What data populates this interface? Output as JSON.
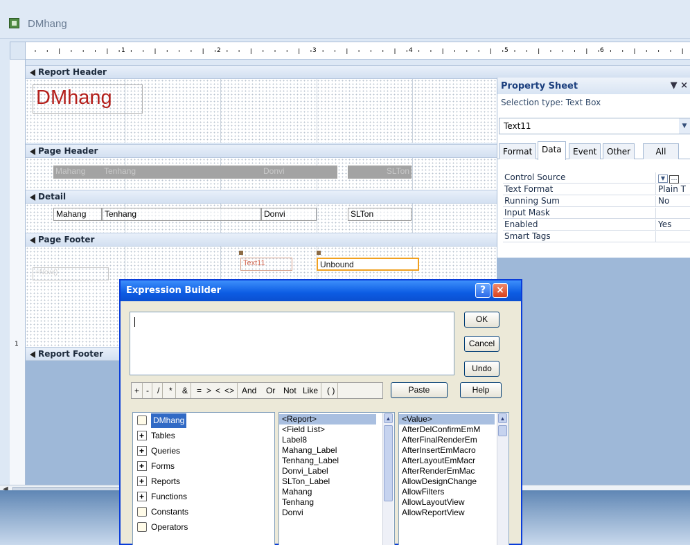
{
  "window": {
    "title": "DMhang",
    "icon": "report-icon"
  },
  "ruler": {
    "marks": [
      "1",
      "2",
      "3",
      "4",
      "5",
      "6"
    ],
    "vertical_marks": [
      "1"
    ]
  },
  "sections": {
    "report_header": "Report Header",
    "page_header": "Page Header",
    "detail": "Detail",
    "page_footer": "Page Footer",
    "report_footer": "Report Footer"
  },
  "report_header": {
    "title_label": "DMhang"
  },
  "page_header": {
    "labels": [
      "Mahang",
      "Tenhang",
      "Donvi",
      "SLTon"
    ]
  },
  "detail": {
    "fields": [
      "Mahang",
      "Tenhang",
      "Donvi",
      "SLTon"
    ]
  },
  "page_footer": {
    "text11": "Text11",
    "unbound": "Unbound",
    "left_field": "=Now()"
  },
  "property_sheet": {
    "title": "Property Sheet",
    "close": "▼ ×",
    "selection_type": "Selection type:  Text Box",
    "selected_control": "Text11",
    "tabs": [
      "Format",
      "Data",
      "Event",
      "Other",
      "All"
    ],
    "active_tab": "Data",
    "rows": [
      {
        "key": "Control Source",
        "value": ""
      },
      {
        "key": "Text Format",
        "value": "Plain T"
      },
      {
        "key": "Running Sum",
        "value": "No"
      },
      {
        "key": "Input Mask",
        "value": ""
      },
      {
        "key": "Enabled",
        "value": "Yes"
      },
      {
        "key": "Smart Tags",
        "value": ""
      }
    ]
  },
  "expression_builder": {
    "title": "Expression Builder",
    "expression": "",
    "buttons": {
      "ok": "OK",
      "cancel": "Cancel",
      "undo": "Undo",
      "paste": "Paste",
      "help": "Help"
    },
    "operators": [
      "+",
      "-",
      "/",
      "*",
      "&",
      "=",
      ">",
      "<",
      "<>",
      "And",
      "Or",
      "Not",
      "Like",
      "( )"
    ],
    "tree": [
      {
        "label": "DMhang",
        "icon": "open-folder-icon",
        "selected": true
      },
      {
        "label": "Tables",
        "icon": "plus-folder-icon"
      },
      {
        "label": "Queries",
        "icon": "plus-folder-icon"
      },
      {
        "label": "Forms",
        "icon": "plus-folder-icon"
      },
      {
        "label": "Reports",
        "icon": "plus-folder-icon"
      },
      {
        "label": "Functions",
        "icon": "plus-folder-icon"
      },
      {
        "label": "Constants",
        "icon": "folder-icon"
      },
      {
        "label": "Operators",
        "icon": "folder-icon"
      }
    ],
    "middle_list": [
      "<Report>",
      "<Field List>",
      "Label8",
      "Mahang_Label",
      "Tenhang_Label",
      "Donvi_Label",
      "SLTon_Label",
      "Mahang",
      "Tenhang",
      "Donvi"
    ],
    "right_list": [
      "<Value>",
      "AfterDelConfirmEmM",
      "AfterFinalRenderEm",
      "AfterInsertEmMacro",
      "AfterLayoutEmMacr",
      "AfterRenderEmMac",
      "AllowDesignChange",
      "AllowFilters",
      "AllowLayoutView",
      "AllowReportView"
    ]
  },
  "colors": {
    "accent": "#0a3dd9",
    "title_red": "#b4201c",
    "selection": "#a9bfe0"
  }
}
